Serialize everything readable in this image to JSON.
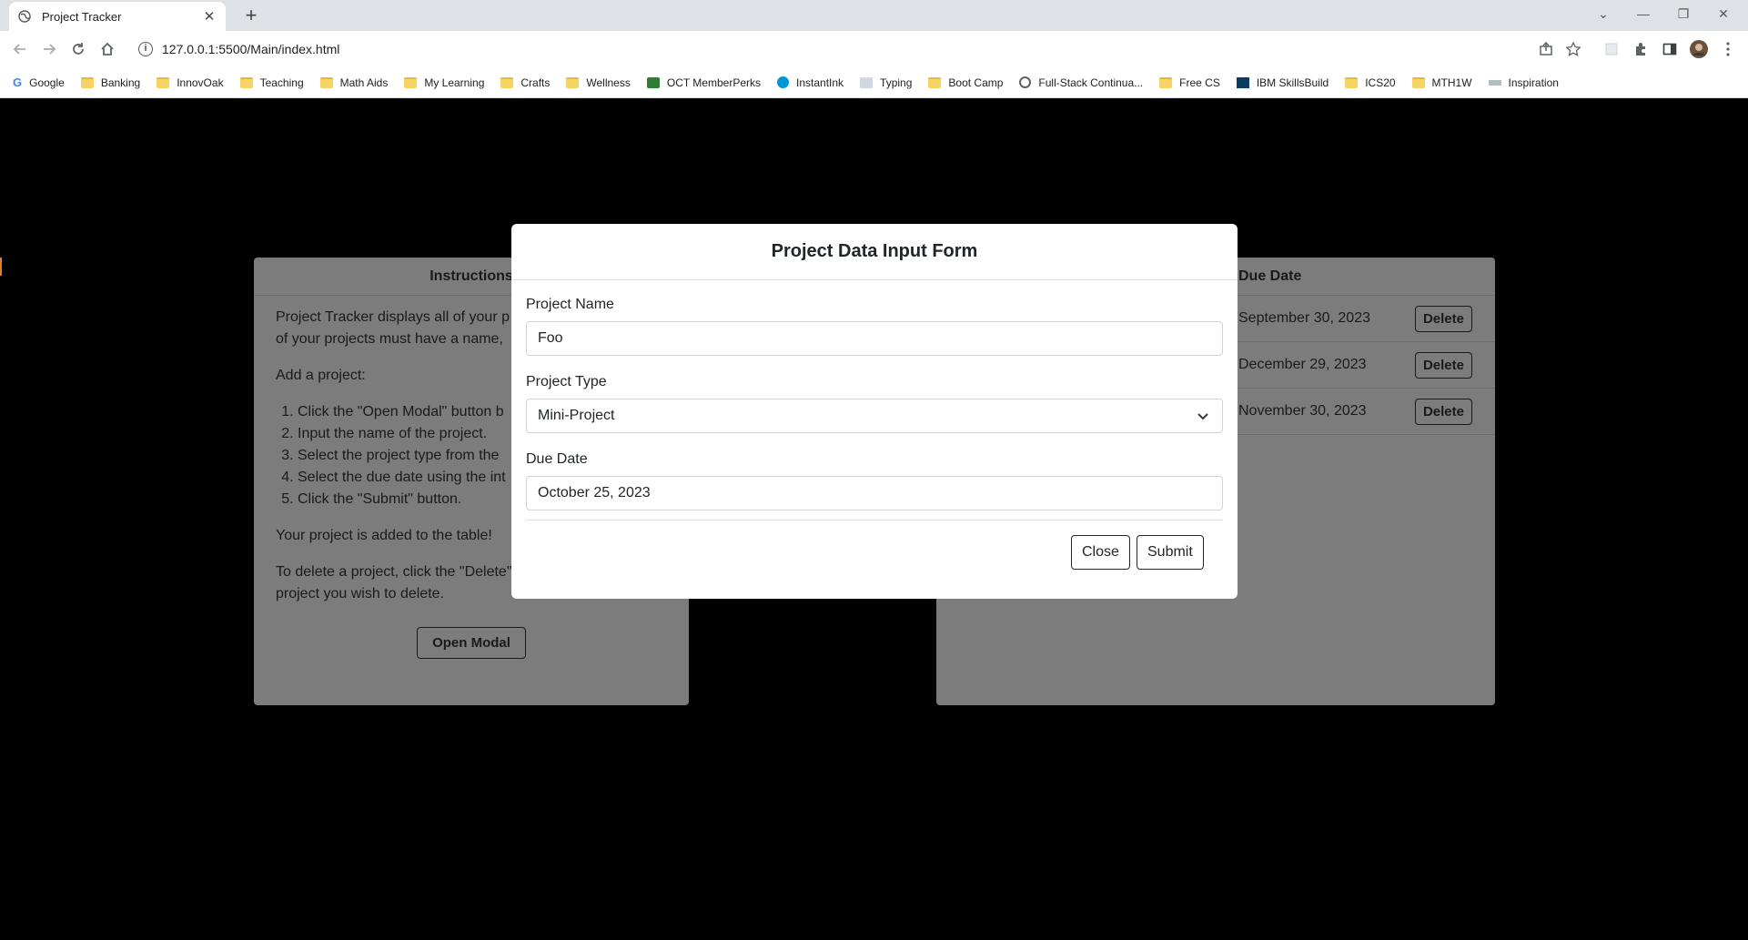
{
  "browser": {
    "tab_title": "Project Tracker",
    "new_tab": "+",
    "url": "127.0.0.1:5500/Main/index.html",
    "bookmarks": [
      "Google",
      "Banking",
      "InnovOak",
      "Teaching",
      "Math Aids",
      "My Learning",
      "Crafts",
      "Wellness",
      "OCT MemberPerks",
      "InstantInk",
      "Typing",
      "Boot Camp",
      "Full-Stack Continua...",
      "Free CS",
      "IBM SkillsBuild",
      "ICS20",
      "MTH1W",
      "Inspiration"
    ]
  },
  "instructions": {
    "header": "Instructions",
    "intro": "Project Tracker displays all of your p",
    "intro_line2": "of your projects must have a name,",
    "add_heading": "Add a project:",
    "steps": [
      "Click the \"Open Modal\" button b",
      "Input the name of the project.",
      "Select the project type from the",
      "Select the due date using the int",
      "Click the \"Submit\" button."
    ],
    "added": "Your project is added to the table!",
    "delete_note": "To delete a project, click the \"Delete\" button net to the project you wish to delete.",
    "open_modal_label": "Open Modal"
  },
  "table": {
    "due_header": "Due Date",
    "rows": [
      {
        "due": "September 30, 2023",
        "action": "Delete"
      },
      {
        "due": "December 29, 2023",
        "action": "Delete"
      },
      {
        "due": "November 30, 2023",
        "action": "Delete"
      }
    ]
  },
  "modal": {
    "title": "Project Data Input Form",
    "name_label": "Project Name",
    "name_value": "Foo",
    "type_label": "Project Type",
    "type_value": "Mini-Project",
    "date_label": "Due Date",
    "date_value": "October 25, 2023",
    "close_label": "Close",
    "submit_label": "Submit"
  },
  "colors": {
    "backdrop": "#000000",
    "card": "#7c7c7c",
    "modal": "#ffffff"
  }
}
